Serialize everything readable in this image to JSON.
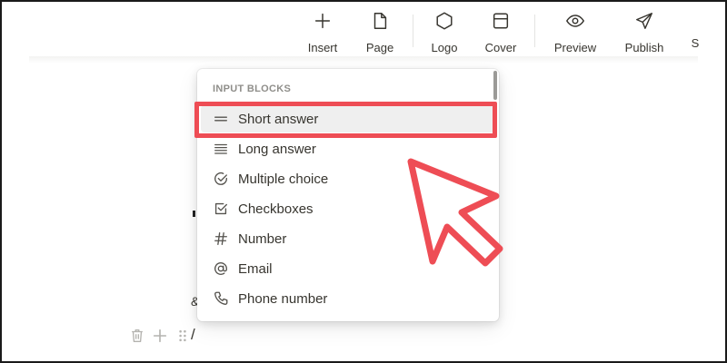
{
  "toolbar": {
    "items": [
      {
        "label": "Insert",
        "icon": "plus-icon"
      },
      {
        "label": "Page",
        "icon": "page-icon"
      },
      {
        "label": "Logo",
        "icon": "hexagon-icon"
      },
      {
        "label": "Cover",
        "icon": "cover-icon"
      },
      {
        "label": "Preview",
        "icon": "eye-icon"
      },
      {
        "label": "Publish",
        "icon": "send-icon"
      },
      {
        "label": "S"
      }
    ]
  },
  "menu": {
    "heading": "INPUT BLOCKS",
    "items": [
      {
        "label": "Short answer",
        "icon": "short-answer-icon",
        "selected": true
      },
      {
        "label": "Long answer",
        "icon": "long-answer-icon"
      },
      {
        "label": "Multiple choice",
        "icon": "circle-check-icon"
      },
      {
        "label": "Checkboxes",
        "icon": "square-check-icon"
      },
      {
        "label": "Number",
        "icon": "hash-icon"
      },
      {
        "label": "Email",
        "icon": "at-icon"
      },
      {
        "label": "Phone number",
        "icon": "phone-icon"
      }
    ]
  },
  "editor": {
    "slash_text": "/",
    "fragment_text": "&"
  },
  "colors": {
    "highlight": "#ee4d55",
    "text": "#37352f",
    "muted": "#8f8e8a"
  }
}
